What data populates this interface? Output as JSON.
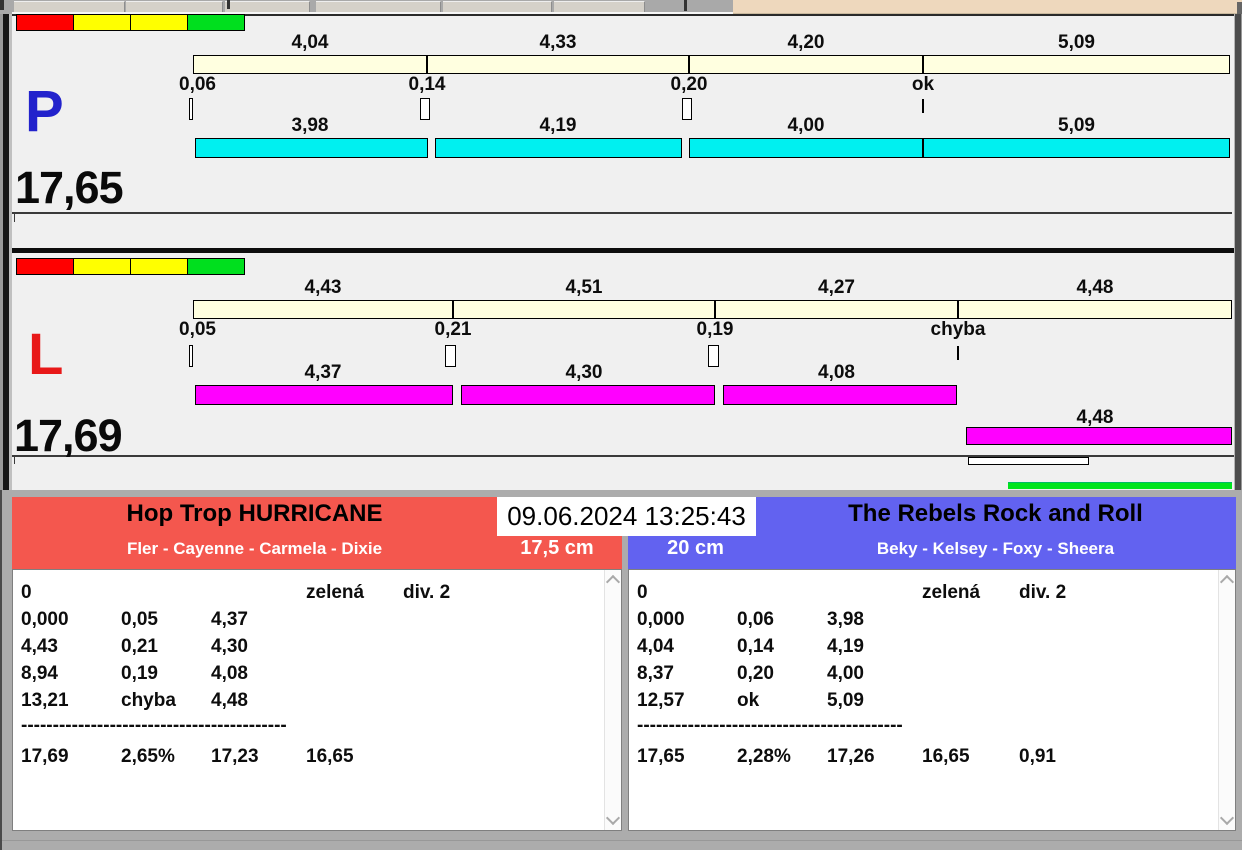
{
  "traffic_light": {
    "colors": [
      "#FF0000",
      "#FFFF00",
      "#FFFF00",
      "#00DF1E"
    ]
  },
  "lanes": {
    "p": {
      "label": "P",
      "label_color": "#2222CC",
      "total": "17,65",
      "split_times": [
        "4,04",
        "4,33",
        "4,20",
        "5,09"
      ],
      "crossings": [
        "0,06",
        "0,14",
        "0,20",
        "ok"
      ],
      "run_times": [
        "3,98",
        "4,19",
        "4,00",
        "5,09"
      ],
      "split_bar_color": "#FFFFE0",
      "run_bar_color": "#00F0F0"
    },
    "l": {
      "label": "L",
      "label_color": "#E81818",
      "total": "17,69",
      "split_times": [
        "4,43",
        "4,51",
        "4,27",
        "4,48"
      ],
      "crossings": [
        "0,05",
        "0,21",
        "0,19",
        "chyba"
      ],
      "run_times": [
        "4,37",
        "4,30",
        "4,08",
        "4,48"
      ],
      "split_bar_color": "#FFFFE0",
      "run_bar_color": "#FF00FF"
    }
  },
  "progress": {
    "green_bar_color": "#00E41C"
  },
  "datetime": "09.06.2024 13:25:43",
  "teams": {
    "left": {
      "name": "Hop Trop HURRICANE",
      "dogs": "Fler - Cayenne - Carmela - Dixie",
      "jump_height": "17,5 cm",
      "color": "#F4574E"
    },
    "right": {
      "name": "The Rebels Rock and Roll",
      "dogs": "Beky - Kelsey - Foxy - Sheera",
      "jump_height": "20 cm",
      "color": "#6262F0"
    }
  },
  "results": {
    "left": {
      "header": [
        "0",
        "zelená",
        "div. 2"
      ],
      "rows": [
        [
          "0,000",
          "0,05",
          "4,37"
        ],
        [
          "4,43",
          "0,21",
          "4,30"
        ],
        [
          "8,94",
          "0,19",
          "4,08"
        ],
        [
          "13,21",
          "chyba",
          "4,48"
        ]
      ],
      "divider": "------------------------------------------",
      "totals": [
        "17,69",
        "2,65%",
        "17,23",
        "16,65"
      ]
    },
    "right": {
      "header": [
        "0",
        "zelená",
        "div. 2"
      ],
      "rows": [
        [
          "0,000",
          "0,06",
          "3,98"
        ],
        [
          "4,04",
          "0,14",
          "4,19"
        ],
        [
          "8,37",
          "0,20",
          "4,00"
        ],
        [
          "12,57",
          "ok",
          "5,09"
        ]
      ],
      "divider": "------------------------------------------",
      "totals": [
        "17,65",
        "2,28%",
        "17,26",
        "16,65",
        "0,91"
      ]
    }
  }
}
